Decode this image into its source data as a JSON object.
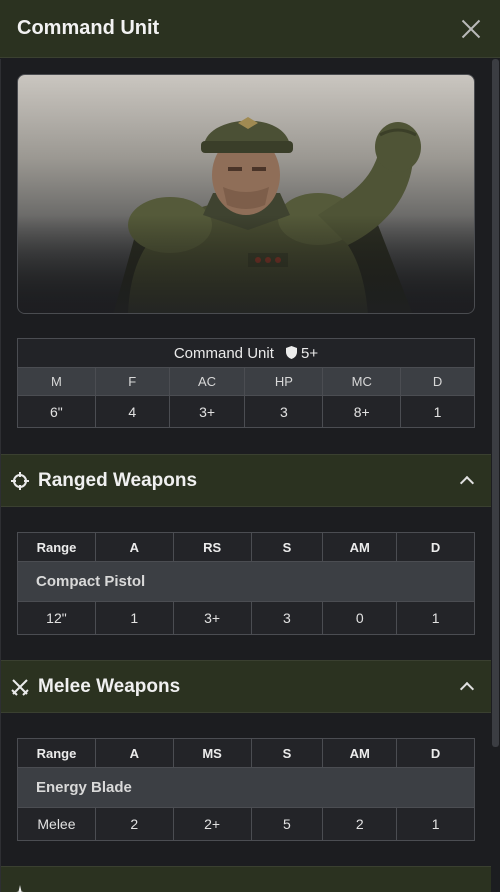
{
  "header": {
    "title": "Command Unit"
  },
  "unit": {
    "name": "Command Unit",
    "save": "5+",
    "stat_headers": [
      "M",
      "F",
      "AC",
      "HP",
      "MC",
      "D"
    ],
    "stat_values": [
      "6\"",
      "4",
      "3+",
      "3",
      "8+",
      "1"
    ]
  },
  "ranged": {
    "title": "Ranged Weapons",
    "headers": [
      "Range",
      "A",
      "RS",
      "S",
      "AM",
      "D"
    ],
    "weapons": [
      {
        "name": "Compact Pistol",
        "values": [
          "12\"",
          "1",
          "3+",
          "3",
          "0",
          "1"
        ]
      }
    ]
  },
  "melee": {
    "title": "Melee Weapons",
    "headers": [
      "Range",
      "A",
      "MS",
      "S",
      "AM",
      "D"
    ],
    "weapons": [
      {
        "name": "Energy Blade",
        "values": [
          "Melee",
          "2",
          "2+",
          "5",
          "2",
          "1"
        ]
      }
    ]
  },
  "colors": {
    "header_bg": "#2b3220",
    "panel_bg": "#1c1d20",
    "table_header": "#3c3f44"
  },
  "icons": [
    "close-icon",
    "shield-icon",
    "crosshair-icon",
    "crossed-swords-icon",
    "chevron-up-icon"
  ]
}
